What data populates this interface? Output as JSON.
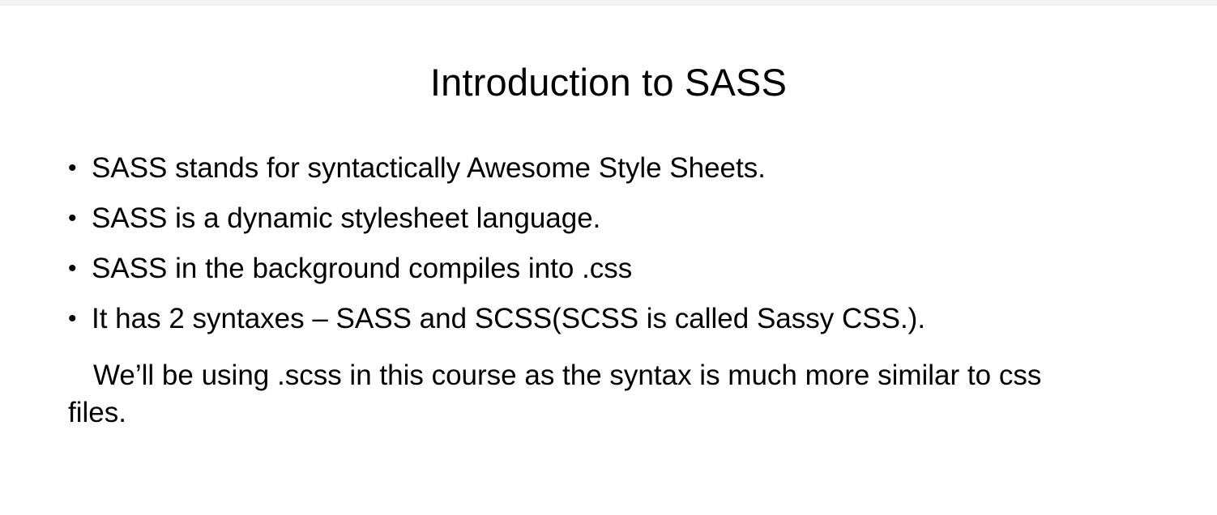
{
  "slide": {
    "title": "Introduction to SASS",
    "bullet_symbol": "•",
    "bullets": [
      "SASS stands for syntactically Awesome Style Sheets.",
      "SASS is a dynamic stylesheet language.",
      "SASS in the background compiles into .css",
      "It has 2 syntaxes – SASS and SCSS(SCSS is called Sassy CSS.)."
    ],
    "continuation": "We’ll be using .scss in this course as the syntax is much more similar to css files."
  }
}
